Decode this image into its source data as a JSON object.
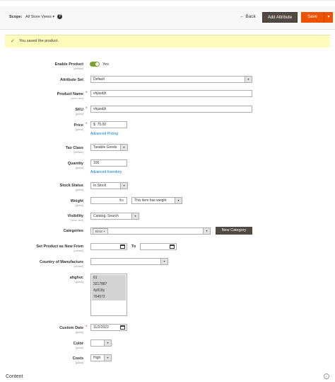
{
  "toolbar": {
    "scope_label": "Scope:",
    "scope_value": "All Store Views",
    "help": "?",
    "back_label": "Back",
    "add_attribute_label": "Add Attribute",
    "save_label": "Save"
  },
  "message": {
    "text": "You saved the product."
  },
  "fields": {
    "enable_product": {
      "label": "Enable Product",
      "scope": "[website]",
      "value": "Yes"
    },
    "attribute_set": {
      "label": "Attribute Set",
      "value": "Default"
    },
    "product_name": {
      "label": "Product Name",
      "scope": "[store view]",
      "value": "vhjasdjh"
    },
    "sku": {
      "label": "SKU",
      "scope": "[global]",
      "value": "vhjasdjh"
    },
    "price": {
      "label": "Price",
      "scope": "[global]",
      "currency": "$",
      "value": "75.00",
      "link": "Advanced Pricing"
    },
    "tax_class": {
      "label": "Tax Class",
      "scope": "[website]",
      "value": "Taxable Goods"
    },
    "quantity": {
      "label": "Quantity",
      "scope": "[global]",
      "value": "100",
      "link": "Advanced Inventory"
    },
    "stock_status": {
      "label": "Stock Status",
      "scope": "[global]",
      "value": "In Stock"
    },
    "weight": {
      "label": "Weight",
      "scope": "[global]",
      "unit": "lbs",
      "type_value": "This item has weight"
    },
    "visibility": {
      "label": "Visibility",
      "scope": "[store view]",
      "value": "Catalog, Search"
    },
    "categories": {
      "label": "Categories",
      "tag": "Error",
      "new_button": "New Category"
    },
    "new_from": {
      "label": "Set Product as New From",
      "scope": "[website]",
      "to_label": "To"
    },
    "country": {
      "label": "Country of Manufacture",
      "scope": "[website]"
    },
    "ahghvc": {
      "label": "ahghvc",
      "scope": "[global]",
      "options": [
        "61",
        "3217887",
        "4y818y",
        "764572"
      ]
    },
    "custom_date": {
      "label": "Custom Date",
      "scope": "[global]",
      "value": "11/2/2022"
    },
    "color": {
      "label": "Color",
      "scope": "[global]"
    },
    "costs": {
      "label": "Costs",
      "scope": "[global]",
      "value": "High"
    }
  },
  "section": {
    "content_title": "Content"
  }
}
